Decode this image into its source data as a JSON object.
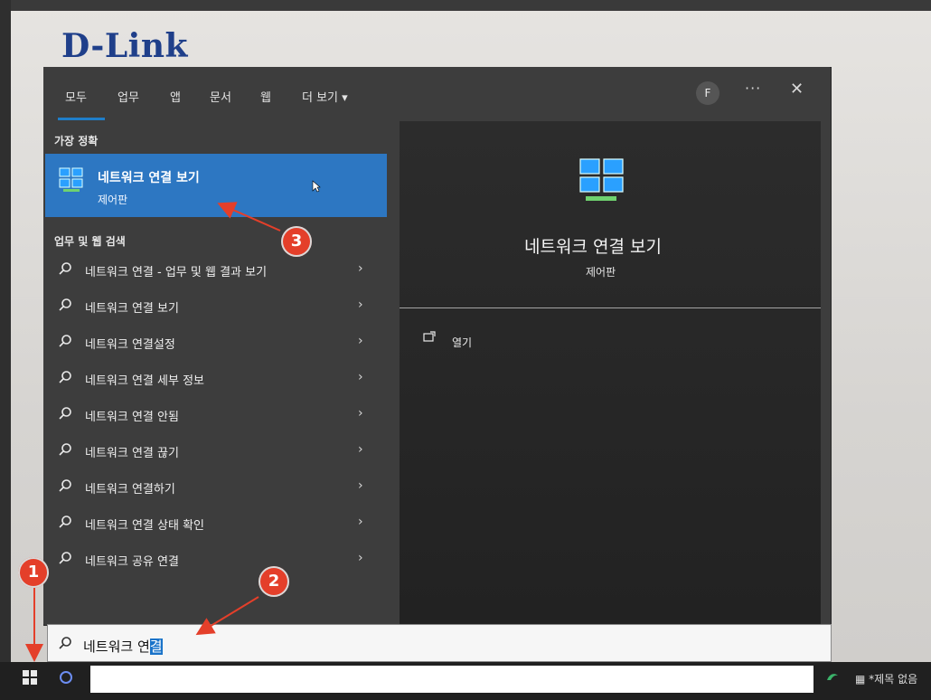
{
  "brand": {
    "name": "D-Link"
  },
  "start_menu": {
    "tabs": [
      "모두",
      "업무",
      "앱",
      "문서",
      "웹",
      "더 보기 ▾"
    ],
    "avatar_letter": "F",
    "more_label": "···",
    "close_label": "✕",
    "best_match_title": "가장 정확",
    "best_match": {
      "title": "네트워크 연결 보기",
      "subtitle": "제어판"
    },
    "web_section_title": "업무 및 웹 검색",
    "suggestions": [
      "네트워크 연결 - 업무 및 웹 결과 보기",
      "네트워크 연결 보기",
      "네트워크 연결설정",
      "네트워크 연결 세부 정보",
      "네트워크 연결 안됨",
      "네트워크 연결 끊기",
      "네트워크 연결하기",
      "네트워크 연결 상태 확인",
      "네트워크 공유 연결"
    ],
    "right_pane": {
      "title": "네트워크 연결 보기",
      "subtitle": "제어판",
      "action_open": "열기"
    },
    "search": {
      "prefix": "네트워크 연",
      "selected": "결"
    }
  },
  "taskbar": {
    "notepad_label": "*제목 없음"
  },
  "annotations": {
    "badge_1": "1",
    "badge_2": "2",
    "badge_3": "3"
  }
}
